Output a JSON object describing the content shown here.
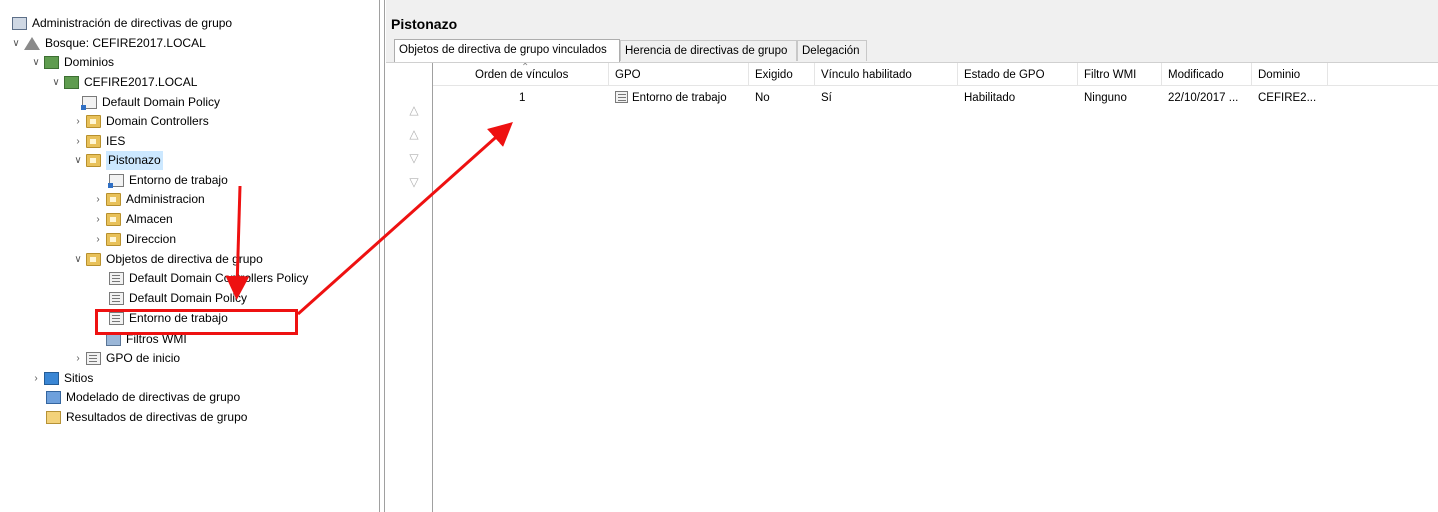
{
  "tree": {
    "root": "Administración de directivas de grupo",
    "forest": "Bosque: CEFIRE2017.LOCAL",
    "domains": "Dominios",
    "domain": "CEFIRE2017.LOCAL",
    "default_domain_policy": "Default Domain Policy",
    "domain_controllers": "Domain Controllers",
    "ies": "IES",
    "pistonazo": "Pistonazo",
    "entorno_link": "Entorno de trabajo",
    "administracion": "Administracion",
    "almacen": "Almacen",
    "direccion": "Direccion",
    "gpo_objects": "Objetos de directiva de grupo",
    "gpo_dc_policy": "Default Domain Controllers Policy",
    "gpo_domain_policy": "Default Domain Policy",
    "gpo_entorno": "Entorno de trabajo",
    "wmi_filters": "Filtros WMI",
    "starter_gpo": "GPO de inicio",
    "sites": "Sitios",
    "modeling": "Modelado de directivas de grupo",
    "results": "Resultados de directivas de grupo"
  },
  "panel": {
    "title": "Pistonazo",
    "tabs": [
      {
        "label": "Objetos de directiva de grupo vinculados"
      },
      {
        "label": "Herencia de directivas de grupo"
      },
      {
        "label": "Delegación"
      }
    ]
  },
  "table": {
    "columns": [
      "Orden de vínculos",
      "GPO",
      "Exigido",
      "Vínculo habilitado",
      "Estado de GPO",
      "Filtro WMI",
      "Modificado",
      "Dominio"
    ],
    "rows": [
      {
        "order": "1",
        "gpo": "Entorno de trabajo",
        "enforced": "No",
        "link_enabled": "Sí",
        "status": "Habilitado",
        "wmi": "Ninguno",
        "modified": "22/10/2017 ...",
        "domain": "CEFIRE2..."
      }
    ]
  },
  "annotation_color": "#ee1111"
}
